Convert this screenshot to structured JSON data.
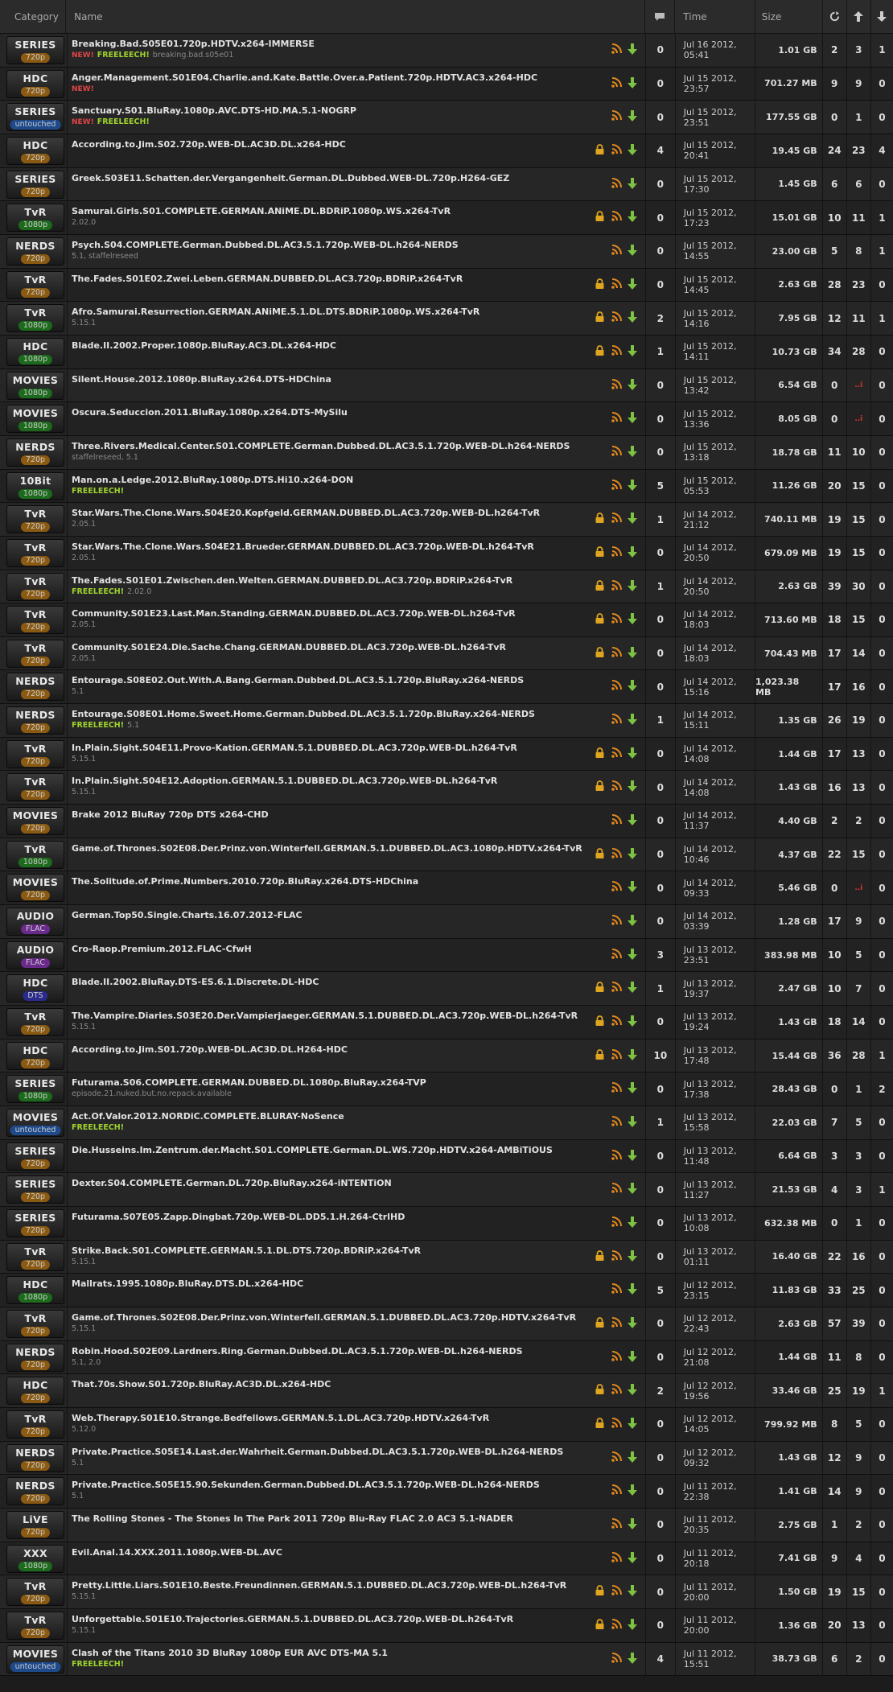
{
  "header": {
    "category": "Category",
    "name": "Name",
    "time": "Time",
    "size": "Size"
  },
  "rows": [
    {
      "cat": "SERIES",
      "sub": "720p",
      "subType": "720",
      "name": "Breaking.Bad.S05E01.720p.HDTV.x264-IMMERSE",
      "new": true,
      "free": true,
      "extra": "breaking.bad.s05e01",
      "lock": false,
      "com": "0",
      "time": "Jul 16 2012, 05:41",
      "size": "1.01 GB",
      "s": "2",
      "l": "3",
      "c": "1"
    },
    {
      "cat": "HDC",
      "sub": "720p",
      "subType": "720",
      "name": "Anger.Management.S01E04.Charlie.and.Kate.Battle.Over.a.Patient.720p.HDTV.AC3.x264-HDC",
      "new": true,
      "free": false,
      "extra": "",
      "lock": false,
      "com": "0",
      "time": "Jul 15 2012, 23:57",
      "size": "701.27 MB",
      "s": "9",
      "l": "9",
      "c": "0"
    },
    {
      "cat": "SERIES",
      "sub": "untouched",
      "subType": "untouched",
      "name": "Sanctuary.S01.BluRay.1080p.AVC.DTS-HD.MA.5.1-NOGRP",
      "new": true,
      "free": true,
      "extra": "",
      "lock": false,
      "com": "0",
      "time": "Jul 15 2012, 23:51",
      "size": "177.55 GB",
      "s": "0",
      "l": "1",
      "c": "0"
    },
    {
      "cat": "HDC",
      "sub": "720p",
      "subType": "720",
      "name": "According.to.Jim.S02.720p.WEB-DL.AC3D.DL.x264-HDC",
      "new": false,
      "free": false,
      "extra": "",
      "lock": true,
      "com": "4",
      "time": "Jul 15 2012, 20:41",
      "size": "19.45 GB",
      "s": "24",
      "l": "23",
      "c": "4"
    },
    {
      "cat": "SERIES",
      "sub": "720p",
      "subType": "720",
      "name": "Greek.S03E11.Schatten.der.Vergangenheit.German.DL.Dubbed.WEB-DL.720p.H264-GEZ",
      "new": false,
      "free": false,
      "extra": "",
      "lock": false,
      "com": "0",
      "time": "Jul 15 2012, 17:30",
      "size": "1.45 GB",
      "s": "6",
      "l": "6",
      "c": "0"
    },
    {
      "cat": "TvR",
      "sub": "1080p",
      "subType": "1080",
      "name": "Samurai.Girls.S01.COMPLETE.GERMAN.ANiME.DL.BDRiP.1080p.WS.x264-TvR",
      "new": false,
      "free": false,
      "extra": "2.02.0",
      "lock": true,
      "com": "0",
      "time": "Jul 15 2012, 17:23",
      "size": "15.01 GB",
      "s": "10",
      "l": "11",
      "c": "1"
    },
    {
      "cat": "NERDS",
      "sub": "720p",
      "subType": "720",
      "name": "Psych.S04.COMPLETE.German.Dubbed.DL.AC3.5.1.720p.WEB-DL.h264-NERDS",
      "new": false,
      "free": false,
      "extra": "5.1, staffelreseed",
      "lock": false,
      "com": "0",
      "time": "Jul 15 2012, 14:55",
      "size": "23.00 GB",
      "s": "5",
      "l": "8",
      "c": "1"
    },
    {
      "cat": "TvR",
      "sub": "720p",
      "subType": "720",
      "name": "The.Fades.S01E02.Zwei.Leben.GERMAN.DUBBED.DL.AC3.720p.BDRiP.x264-TvR",
      "new": false,
      "free": false,
      "extra": "",
      "lock": true,
      "com": "0",
      "time": "Jul 15 2012, 14:45",
      "size": "2.63 GB",
      "s": "28",
      "l": "23",
      "c": "0"
    },
    {
      "cat": "TvR",
      "sub": "1080p",
      "subType": "1080",
      "name": "Afro.Samurai.Resurrection.GERMAN.ANiME.5.1.DL.DTS.BDRiP.1080p.WS.x264-TvR",
      "new": false,
      "free": false,
      "extra": "5.15.1",
      "lock": true,
      "com": "2",
      "time": "Jul 15 2012, 14:16",
      "size": "7.95 GB",
      "s": "12",
      "l": "11",
      "c": "1"
    },
    {
      "cat": "HDC",
      "sub": "1080p",
      "subType": "1080",
      "name": "Blade.II.2002.Proper.1080p.BluRay.AC3.DL.x264-HDC",
      "new": false,
      "free": false,
      "extra": "",
      "lock": true,
      "com": "1",
      "time": "Jul 15 2012, 14:11",
      "size": "10.73 GB",
      "s": "34",
      "l": "28",
      "c": "0"
    },
    {
      "cat": "MOVIES",
      "sub": "1080p",
      "subType": "1080",
      "name": "Silent.House.2012.1080p.BluRay.x264.DTS-HDChina",
      "new": false,
      "free": false,
      "extra": "",
      "lock": false,
      "com": "0",
      "time": "Jul 15 2012, 13:42",
      "size": "6.54 GB",
      "s": "0",
      "l": "..i",
      "c": "0"
    },
    {
      "cat": "MOVIES",
      "sub": "1080p",
      "subType": "1080",
      "name": "Oscura.Seduccion.2011.BluRay.1080p.x264.DTS-MySilu",
      "new": false,
      "free": false,
      "extra": "",
      "lock": false,
      "com": "0",
      "time": "Jul 15 2012, 13:36",
      "size": "8.05 GB",
      "s": "0",
      "l": "..i",
      "c": "0"
    },
    {
      "cat": "NERDS",
      "sub": "720p",
      "subType": "720",
      "name": "Three.Rivers.Medical.Center.S01.COMPLETE.German.Dubbed.DL.AC3.5.1.720p.WEB-DL.h264-NERDS",
      "new": false,
      "free": false,
      "extra": "staffelreseed, 5.1",
      "lock": false,
      "com": "0",
      "time": "Jul 15 2012, 13:18",
      "size": "18.78 GB",
      "s": "11",
      "l": "10",
      "c": "0"
    },
    {
      "cat": "10Bit",
      "sub": "1080p",
      "subType": "1080",
      "name": "Man.on.a.Ledge.2012.BluRay.1080p.DTS.Hi10.x264-DON",
      "new": false,
      "free": true,
      "extra": "",
      "lock": false,
      "com": "5",
      "time": "Jul 15 2012, 05:53",
      "size": "11.26 GB",
      "s": "20",
      "l": "15",
      "c": "0"
    },
    {
      "cat": "TvR",
      "sub": "720p",
      "subType": "720",
      "name": "Star.Wars.The.Clone.Wars.S04E20.Kopfgeld.GERMAN.DUBBED.DL.AC3.720p.WEB-DL.h264-TvR",
      "new": false,
      "free": false,
      "extra": "2.05.1",
      "lock": true,
      "com": "1",
      "time": "Jul 14 2012, 21:12",
      "size": "740.11 MB",
      "s": "19",
      "l": "15",
      "c": "0"
    },
    {
      "cat": "TvR",
      "sub": "720p",
      "subType": "720",
      "name": "Star.Wars.The.Clone.Wars.S04E21.Brueder.GERMAN.DUBBED.DL.AC3.720p.WEB-DL.h264-TvR",
      "new": false,
      "free": false,
      "extra": "2.05.1",
      "lock": true,
      "com": "0",
      "time": "Jul 14 2012, 20:50",
      "size": "679.09 MB",
      "s": "19",
      "l": "15",
      "c": "0"
    },
    {
      "cat": "TvR",
      "sub": "720p",
      "subType": "720",
      "name": "The.Fades.S01E01.Zwischen.den.Welten.GERMAN.DUBBED.DL.AC3.720p.BDRiP.x264-TvR",
      "new": false,
      "free": true,
      "extra": "2.02.0",
      "lock": true,
      "com": "1",
      "time": "Jul 14 2012, 20:50",
      "size": "2.63 GB",
      "s": "39",
      "l": "30",
      "c": "0"
    },
    {
      "cat": "TvR",
      "sub": "720p",
      "subType": "720",
      "name": "Community.S01E23.Last.Man.Standing.GERMAN.DUBBED.DL.AC3.720p.WEB-DL.h264-TvR",
      "new": false,
      "free": false,
      "extra": "2.05.1",
      "lock": true,
      "com": "0",
      "time": "Jul 14 2012, 18:03",
      "size": "713.60 MB",
      "s": "18",
      "l": "15",
      "c": "0"
    },
    {
      "cat": "TvR",
      "sub": "720p",
      "subType": "720",
      "name": "Community.S01E24.Die.Sache.Chang.GERMAN.DUBBED.DL.AC3.720p.WEB-DL.h264-TvR",
      "new": false,
      "free": false,
      "extra": "2.05.1",
      "lock": true,
      "com": "0",
      "time": "Jul 14 2012, 18:03",
      "size": "704.43 MB",
      "s": "17",
      "l": "14",
      "c": "0"
    },
    {
      "cat": "NERDS",
      "sub": "720p",
      "subType": "720",
      "name": "Entourage.S08E02.Out.With.A.Bang.German.Dubbed.DL.AC3.5.1.720p.BluRay.x264-NERDS",
      "new": false,
      "free": false,
      "extra": "5.1",
      "lock": false,
      "com": "0",
      "time": "Jul 14 2012, 15:16",
      "size": "1,023.38 MB",
      "s": "17",
      "l": "16",
      "c": "0"
    },
    {
      "cat": "NERDS",
      "sub": "720p",
      "subType": "720",
      "name": "Entourage.S08E01.Home.Sweet.Home.German.Dubbed.DL.AC3.5.1.720p.BluRay.x264-NERDS",
      "new": false,
      "free": true,
      "extra": "5.1",
      "lock": false,
      "com": "1",
      "time": "Jul 14 2012, 15:11",
      "size": "1.35 GB",
      "s": "26",
      "l": "19",
      "c": "0"
    },
    {
      "cat": "TvR",
      "sub": "720p",
      "subType": "720",
      "name": "In.Plain.Sight.S04E11.Provo-Kation.GERMAN.5.1.DUBBED.DL.AC3.720p.WEB-DL.h264-TvR",
      "new": false,
      "free": false,
      "extra": "5.15.1",
      "lock": true,
      "com": "0",
      "time": "Jul 14 2012, 14:08",
      "size": "1.44 GB",
      "s": "17",
      "l": "13",
      "c": "0"
    },
    {
      "cat": "TvR",
      "sub": "720p",
      "subType": "720",
      "name": "In.Plain.Sight.S04E12.Adoption.GERMAN.5.1.DUBBED.DL.AC3.720p.WEB-DL.h264-TvR",
      "new": false,
      "free": false,
      "extra": "5.15.1",
      "lock": true,
      "com": "0",
      "time": "Jul 14 2012, 14:08",
      "size": "1.43 GB",
      "s": "16",
      "l": "13",
      "c": "0"
    },
    {
      "cat": "MOVIES",
      "sub": "720p",
      "subType": "720",
      "name": "Brake 2012 BluRay 720p DTS x264-CHD",
      "new": false,
      "free": false,
      "extra": "",
      "lock": false,
      "com": "0",
      "time": "Jul 14 2012, 11:37",
      "size": "4.40 GB",
      "s": "2",
      "l": "2",
      "c": "0"
    },
    {
      "cat": "TvR",
      "sub": "1080p",
      "subType": "1080",
      "name": "Game.of.Thrones.S02E08.Der.Prinz.von.Winterfell.GERMAN.5.1.DUBBED.DL.AC3.1080p.HDTV.x264-TvR",
      "new": false,
      "free": false,
      "extra": "",
      "lock": true,
      "com": "0",
      "time": "Jul 14 2012, 10:46",
      "size": "4.37 GB",
      "s": "22",
      "l": "15",
      "c": "0"
    },
    {
      "cat": "MOVIES",
      "sub": "720p",
      "subType": "720",
      "name": "The.Solitude.of.Prime.Numbers.2010.720p.BluRay.x264.DTS-HDChina",
      "new": false,
      "free": false,
      "extra": "",
      "lock": false,
      "com": "0",
      "time": "Jul 14 2012, 09:33",
      "size": "5.46 GB",
      "s": "0",
      "l": "..i",
      "c": "0"
    },
    {
      "cat": "AUDIO",
      "sub": "FLAC",
      "subType": "flac",
      "name": "German.Top50.Single.Charts.16.07.2012-FLAC",
      "new": false,
      "free": false,
      "extra": "",
      "lock": false,
      "com": "0",
      "time": "Jul 14 2012, 03:39",
      "size": "1.28 GB",
      "s": "17",
      "l": "9",
      "c": "0"
    },
    {
      "cat": "AUDIO",
      "sub": "FLAC",
      "subType": "flac",
      "name": "Cro-Raop.Premium.2012.FLAC-CfwH",
      "new": false,
      "free": false,
      "extra": "",
      "lock": false,
      "com": "3",
      "time": "Jul 13 2012, 23:51",
      "size": "383.98 MB",
      "s": "10",
      "l": "5",
      "c": "0"
    },
    {
      "cat": "HDC",
      "sub": "DTS",
      "subType": "dts",
      "name": "Blade.II.2002.BluRay.DTS-ES.6.1.Discrete.DL-HDC",
      "new": false,
      "free": false,
      "extra": "",
      "lock": true,
      "com": "1",
      "time": "Jul 13 2012, 19:37",
      "size": "2.47 GB",
      "s": "10",
      "l": "7",
      "c": "0"
    },
    {
      "cat": "TvR",
      "sub": "720p",
      "subType": "720",
      "name": "The.Vampire.Diaries.S03E20.Der.Vampierjaeger.GERMAN.5.1.DUBBED.DL.AC3.720p.WEB-DL.h264-TvR",
      "new": false,
      "free": false,
      "extra": "5.15.1",
      "lock": true,
      "com": "0",
      "time": "Jul 13 2012, 19:24",
      "size": "1.43 GB",
      "s": "18",
      "l": "14",
      "c": "0"
    },
    {
      "cat": "HDC",
      "sub": "720p",
      "subType": "720",
      "name": "According.to.Jim.S01.720p.WEB-DL.AC3D.DL.H264-HDC",
      "new": false,
      "free": false,
      "extra": "",
      "lock": true,
      "com": "10",
      "time": "Jul 13 2012, 17:48",
      "size": "15.44 GB",
      "s": "36",
      "l": "28",
      "c": "1"
    },
    {
      "cat": "SERIES",
      "sub": "1080p",
      "subType": "1080",
      "name": "Futurama.S06.COMPLETE.GERMAN.DUBBED.DL.1080p.BluRay.x264-TVP",
      "new": false,
      "free": false,
      "extra": "episode.21.nuked.but.no.repack.available",
      "lock": false,
      "com": "0",
      "time": "Jul 13 2012, 17:38",
      "size": "28.43 GB",
      "s": "0",
      "l": "1",
      "c": "2"
    },
    {
      "cat": "MOVIES",
      "sub": "untouched",
      "subType": "untouched",
      "name": "Act.Of.Valor.2012.NORDiC.COMPLETE.BLURAY-NoSence",
      "new": false,
      "free": true,
      "extra": "",
      "lock": false,
      "com": "1",
      "time": "Jul 13 2012, 15:58",
      "size": "22.03 GB",
      "s": "7",
      "l": "5",
      "c": "0"
    },
    {
      "cat": "SERIES",
      "sub": "720p",
      "subType": "720",
      "name": "Die.Husseins.Im.Zentrum.der.Macht.S01.COMPLETE.German.DL.WS.720p.HDTV.x264-AMBiTiOUS",
      "new": false,
      "free": false,
      "extra": "",
      "lock": false,
      "com": "0",
      "time": "Jul 13 2012, 11:48",
      "size": "6.64 GB",
      "s": "3",
      "l": "3",
      "c": "0"
    },
    {
      "cat": "SERIES",
      "sub": "720p",
      "subType": "720",
      "name": "Dexter.S04.COMPLETE.German.DL.720p.BluRay.x264-iNTENTiON",
      "new": false,
      "free": false,
      "extra": "",
      "lock": false,
      "com": "0",
      "time": "Jul 13 2012, 11:27",
      "size": "21.53 GB",
      "s": "4",
      "l": "3",
      "c": "1"
    },
    {
      "cat": "SERIES",
      "sub": "720p",
      "subType": "720",
      "name": "Futurama.S07E05.Zapp.Dingbat.720p.WEB-DL.DD5.1.H.264-CtrlHD",
      "new": false,
      "free": false,
      "extra": "",
      "lock": false,
      "com": "0",
      "time": "Jul 13 2012, 10:08",
      "size": "632.38 MB",
      "s": "0",
      "l": "1",
      "c": "0"
    },
    {
      "cat": "TvR",
      "sub": "720p",
      "subType": "720",
      "name": "Strike.Back.S01.COMPLETE.GERMAN.5.1.DL.DTS.720p.BDRiP.x264-TvR",
      "new": false,
      "free": false,
      "extra": "5.15.1",
      "lock": true,
      "com": "0",
      "time": "Jul 13 2012, 01:11",
      "size": "16.40 GB",
      "s": "22",
      "l": "16",
      "c": "0"
    },
    {
      "cat": "HDC",
      "sub": "1080p",
      "subType": "1080",
      "name": "Mallrats.1995.1080p.BluRay.DTS.DL.x264-HDC",
      "new": false,
      "free": false,
      "extra": "",
      "lock": false,
      "com": "5",
      "time": "Jul 12 2012, 23:15",
      "size": "11.83 GB",
      "s": "33",
      "l": "25",
      "c": "0"
    },
    {
      "cat": "TvR",
      "sub": "720p",
      "subType": "720",
      "name": "Game.of.Thrones.S02E08.Der.Prinz.von.Winterfell.GERMAN.5.1.DUBBED.DL.AC3.720p.HDTV.x264-TvR",
      "new": false,
      "free": false,
      "extra": "5.15.1",
      "lock": true,
      "com": "0",
      "time": "Jul 12 2012, 22:43",
      "size": "2.63 GB",
      "s": "57",
      "l": "39",
      "c": "0"
    },
    {
      "cat": "NERDS",
      "sub": "720p",
      "subType": "720",
      "name": "Robin.Hood.S02E09.Lardners.Ring.German.Dubbed.DL.AC3.5.1.720p.WEB-DL.h264-NERDS",
      "new": false,
      "free": false,
      "extra": "5.1, 2.0",
      "lock": false,
      "com": "0",
      "time": "Jul 12 2012, 21:08",
      "size": "1.44 GB",
      "s": "11",
      "l": "8",
      "c": "0"
    },
    {
      "cat": "HDC",
      "sub": "720p",
      "subType": "720",
      "name": "That.70s.Show.S01.720p.BluRay.AC3D.DL.x264-HDC",
      "new": false,
      "free": false,
      "extra": "",
      "lock": true,
      "com": "2",
      "time": "Jul 12 2012, 19:56",
      "size": "33.46 GB",
      "s": "25",
      "l": "19",
      "c": "1"
    },
    {
      "cat": "TvR",
      "sub": "720p",
      "subType": "720",
      "name": "Web.Therapy.S01E10.Strange.Bedfellows.GERMAN.5.1.DL.AC3.720p.HDTV.x264-TvR",
      "new": false,
      "free": false,
      "extra": "5.12.0",
      "lock": true,
      "com": "0",
      "time": "Jul 12 2012, 14:05",
      "size": "799.92 MB",
      "s": "8",
      "l": "5",
      "c": "0"
    },
    {
      "cat": "NERDS",
      "sub": "720p",
      "subType": "720",
      "name": "Private.Practice.S05E14.Last.der.Wahrheit.German.Dubbed.DL.AC3.5.1.720p.WEB-DL.h264-NERDS",
      "new": false,
      "free": false,
      "extra": "5.1",
      "lock": false,
      "com": "0",
      "time": "Jul 12 2012, 09:32",
      "size": "1.43 GB",
      "s": "12",
      "l": "9",
      "c": "0"
    },
    {
      "cat": "NERDS",
      "sub": "720p",
      "subType": "720",
      "name": "Private.Practice.S05E15.90.Sekunden.German.Dubbed.DL.AC3.5.1.720p.WEB-DL.h264-NERDS",
      "new": false,
      "free": false,
      "extra": "5.1",
      "lock": false,
      "com": "0",
      "time": "Jul 11 2012, 22:38",
      "size": "1.41 GB",
      "s": "14",
      "l": "9",
      "c": "0"
    },
    {
      "cat": "LiVE",
      "sub": "720p",
      "subType": "720",
      "name": "The Rolling Stones - The Stones In The Park 2011 720p Blu-Ray FLAC 2.0 AC3 5.1-NADER",
      "new": false,
      "free": false,
      "extra": "",
      "lock": false,
      "com": "0",
      "time": "Jul 11 2012, 20:35",
      "size": "2.75 GB",
      "s": "1",
      "l": "2",
      "c": "0"
    },
    {
      "cat": "XXX",
      "sub": "1080p",
      "subType": "1080",
      "name": "Evil.Anal.14.XXX.2011.1080p.WEB-DL.AVC",
      "new": false,
      "free": false,
      "extra": "",
      "lock": false,
      "com": "0",
      "time": "Jul 11 2012, 20:18",
      "size": "7.41 GB",
      "s": "9",
      "l": "4",
      "c": "0"
    },
    {
      "cat": "TvR",
      "sub": "720p",
      "subType": "720",
      "name": "Pretty.Little.Liars.S01E10.Beste.Freundinnen.GERMAN.5.1.DUBBED.DL.AC3.720p.WEB-DL.h264-TvR",
      "new": false,
      "free": false,
      "extra": "5.15.1",
      "lock": true,
      "com": "0",
      "time": "Jul 11 2012, 20:00",
      "size": "1.50 GB",
      "s": "19",
      "l": "15",
      "c": "0"
    },
    {
      "cat": "TvR",
      "sub": "720p",
      "subType": "720",
      "name": "Unforgettable.S01E10.Trajectories.GERMAN.5.1.DUBBED.DL.AC3.720p.WEB-DL.h264-TvR",
      "new": false,
      "free": false,
      "extra": "5.15.1",
      "lock": true,
      "com": "0",
      "time": "Jul 11 2012, 20:00",
      "size": "1.36 GB",
      "s": "20",
      "l": "13",
      "c": "0"
    },
    {
      "cat": "MOVIES",
      "sub": "untouched",
      "subType": "untouched",
      "name": "Clash of the Titans 2010 3D BluRay 1080p EUR AVC DTS-MA 5.1",
      "new": false,
      "free": true,
      "extra": "",
      "lock": false,
      "com": "4",
      "time": "Jul 11 2012, 15:51",
      "size": "38.73 GB",
      "s": "6",
      "l": "2",
      "c": "0"
    }
  ],
  "labels": {
    "new": "NEW!",
    "free": "FREELEECH!"
  },
  "colors": {
    "720": "#8a5a12",
    "1080": "#1c6a1c",
    "untouched": "#1e4a8c",
    "flac": "#6a2a8c",
    "dts": "#2a2a8a",
    "rss": "#e58a1e",
    "down": "#7dc242",
    "lock": "#e0a520"
  }
}
